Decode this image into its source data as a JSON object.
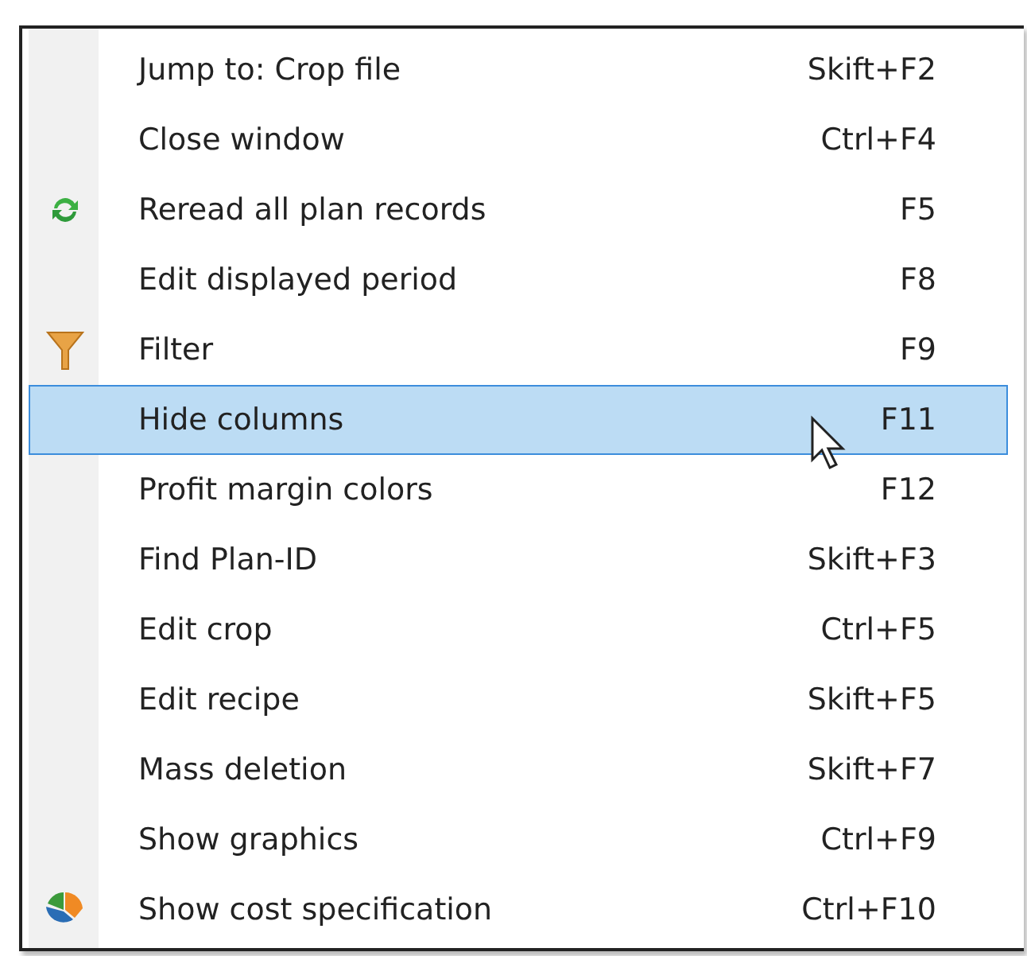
{
  "menu": {
    "items": [
      {
        "label": "Jump to: Crop file",
        "shortcut": "Skift+F2",
        "selected": false
      },
      {
        "label": "Close window",
        "shortcut": "Ctrl+F4",
        "selected": false
      },
      {
        "label": "Reread all plan records",
        "shortcut": "F5",
        "selected": false
      },
      {
        "label": "Edit displayed period",
        "shortcut": "F8",
        "selected": false
      },
      {
        "label": "Filter",
        "shortcut": "F9",
        "selected": false
      },
      {
        "label": "Hide columns",
        "shortcut": "F11",
        "selected": true
      },
      {
        "label": "Profit margin colors",
        "shortcut": "F12",
        "selected": false
      },
      {
        "label": "Find Plan-ID",
        "shortcut": "Skift+F3",
        "selected": false
      },
      {
        "label": "Edit crop",
        "shortcut": "Ctrl+F5",
        "selected": false
      },
      {
        "label": "Edit recipe",
        "shortcut": "Skift+F5",
        "selected": false
      },
      {
        "label": "Mass deletion",
        "shortcut": "Skift+F7",
        "selected": false
      },
      {
        "label": "Show graphics",
        "shortcut": "Ctrl+F9",
        "selected": false
      },
      {
        "label": "Show cost specification",
        "shortcut": "Ctrl+F10",
        "selected": false
      }
    ]
  }
}
